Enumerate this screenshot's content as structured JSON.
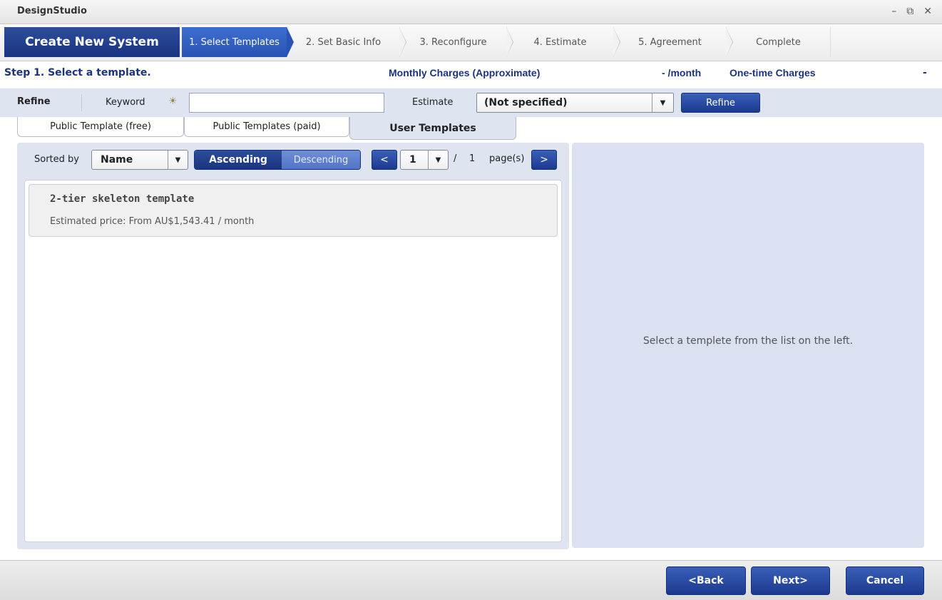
{
  "window": {
    "title": "DesignStudio",
    "controls": {
      "minimize": "–",
      "restore": "⧉",
      "close": "✕"
    }
  },
  "wizard": {
    "title": "Create New System",
    "steps": [
      {
        "label": "1. Select Templates",
        "active": true
      },
      {
        "label": "2. Set Basic Info",
        "active": false
      },
      {
        "label": "3. Reconfigure",
        "active": false
      },
      {
        "label": "4. Estimate",
        "active": false
      },
      {
        "label": "5. Agreement",
        "active": false
      },
      {
        "label": "Complete",
        "active": false
      }
    ]
  },
  "info": {
    "step_label": "Step 1. Select a template.",
    "monthly_label": "Monthly Charges (Approximate)",
    "monthly_value": "- /month",
    "onetime_label": "One-time Charges",
    "onetime_value": "-"
  },
  "refine": {
    "label": "Refine",
    "keyword_label": "Keyword",
    "keyword_value": "",
    "estimate_label": "Estimate",
    "estimate_value": "(Not specified)",
    "button_label": "Refine"
  },
  "tabs": [
    {
      "label": "Public Template (free)",
      "selected": false
    },
    {
      "label": "Public Templates (paid)",
      "selected": false
    },
    {
      "label": "User Templates",
      "selected": true
    }
  ],
  "sort": {
    "label": "Sorted by",
    "value": "Name",
    "ascending_label": "Ascending",
    "descending_label": "Descending",
    "active_order": "ascending"
  },
  "pagination": {
    "prev": "<",
    "current": "1",
    "slash": "/",
    "total": "1",
    "label": "page(s)",
    "next": ">"
  },
  "templates": [
    {
      "name": "2-tier skeleton template",
      "price": "Estimated price: From AU$1,543.41 / month"
    }
  ],
  "detail": {
    "hint": "Select a templete from the list on the left."
  },
  "footer": {
    "back_label": "<Back",
    "next_label": "Next>",
    "cancel_label": "Cancel"
  }
}
